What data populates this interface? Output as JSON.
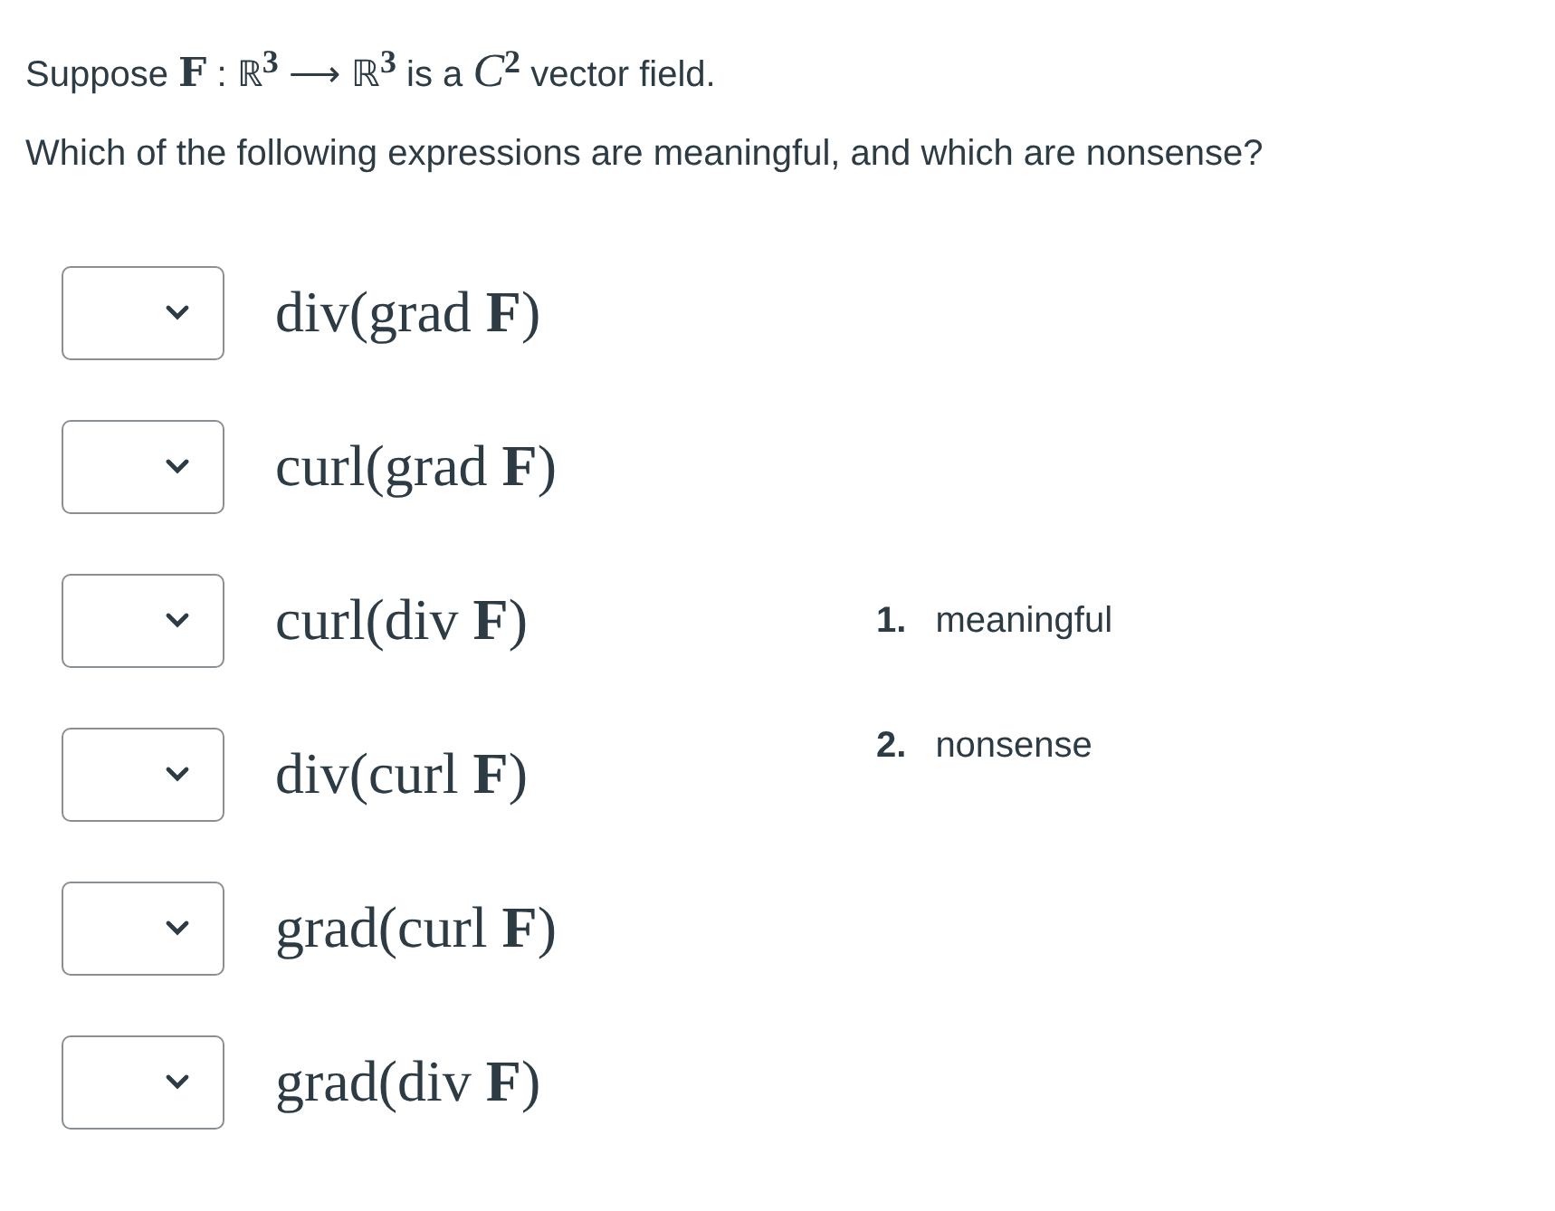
{
  "prompt": "Suppose **F** : ℝ$^{3}$ ⟶ ℝ$^{3}$ is a *C*$^{2}$ vector field.",
  "question": "Which of the following expressions are meaningful, and which are nonsense?",
  "items": [
    {
      "expression": "div(grad **F**)"
    },
    {
      "expression": "curl(grad **F**)"
    },
    {
      "expression": "curl(div **F**)"
    },
    {
      "expression": "div(curl **F**)"
    },
    {
      "expression": "grad(curl **F**)"
    },
    {
      "expression": "grad(div **F**)"
    }
  ],
  "options": [
    {
      "number": "1.",
      "label": "meaningful"
    },
    {
      "number": "2.",
      "label": "nonsense"
    }
  ]
}
